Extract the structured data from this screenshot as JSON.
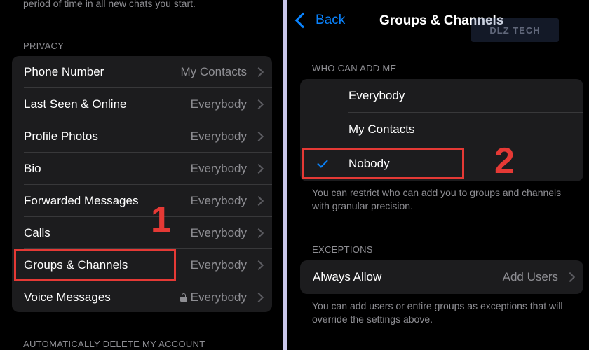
{
  "left_panel": {
    "top_caption": "period of time in all new chats you start.",
    "privacy_header": "PRIVACY",
    "rows": [
      {
        "label": "Phone Number",
        "value": "My Contacts"
      },
      {
        "label": "Last Seen & Online",
        "value": "Everybody"
      },
      {
        "label": "Profile Photos",
        "value": "Everybody"
      },
      {
        "label": "Bio",
        "value": "Everybody"
      },
      {
        "label": "Forwarded Messages",
        "value": "Everybody"
      },
      {
        "label": "Calls",
        "value": "Everybody"
      },
      {
        "label": "Groups & Channels",
        "value": "Everybody"
      },
      {
        "label": "Voice Messages",
        "value": "Everybody",
        "icon": "lock-icon"
      }
    ],
    "bottom_header": "AUTOMATICALLY DELETE MY ACCOUNT",
    "step_number": "1"
  },
  "right_panel": {
    "back_label": "Back",
    "title": "Groups & Channels",
    "watermark": "DLZ TECH",
    "who_header": "WHO CAN ADD ME",
    "options": [
      {
        "label": "Everybody",
        "selected": false
      },
      {
        "label": "My Contacts",
        "selected": false
      },
      {
        "label": "Nobody",
        "selected": true
      }
    ],
    "options_footer": "You can restrict who can add you to groups and channels with granular precision.",
    "exceptions_header": "EXCEPTIONS",
    "always_allow": {
      "label": "Always Allow",
      "value": "Add Users"
    },
    "exceptions_footer": "You can add users or entire groups as exceptions that will override the settings above.",
    "step_number": "2"
  },
  "colors": {
    "accent": "#0a84ff",
    "highlight": "#e53935",
    "cell_background": "#1c1c1e",
    "secondary_text": "#8e8e93",
    "divider": "#c9c6ea"
  }
}
